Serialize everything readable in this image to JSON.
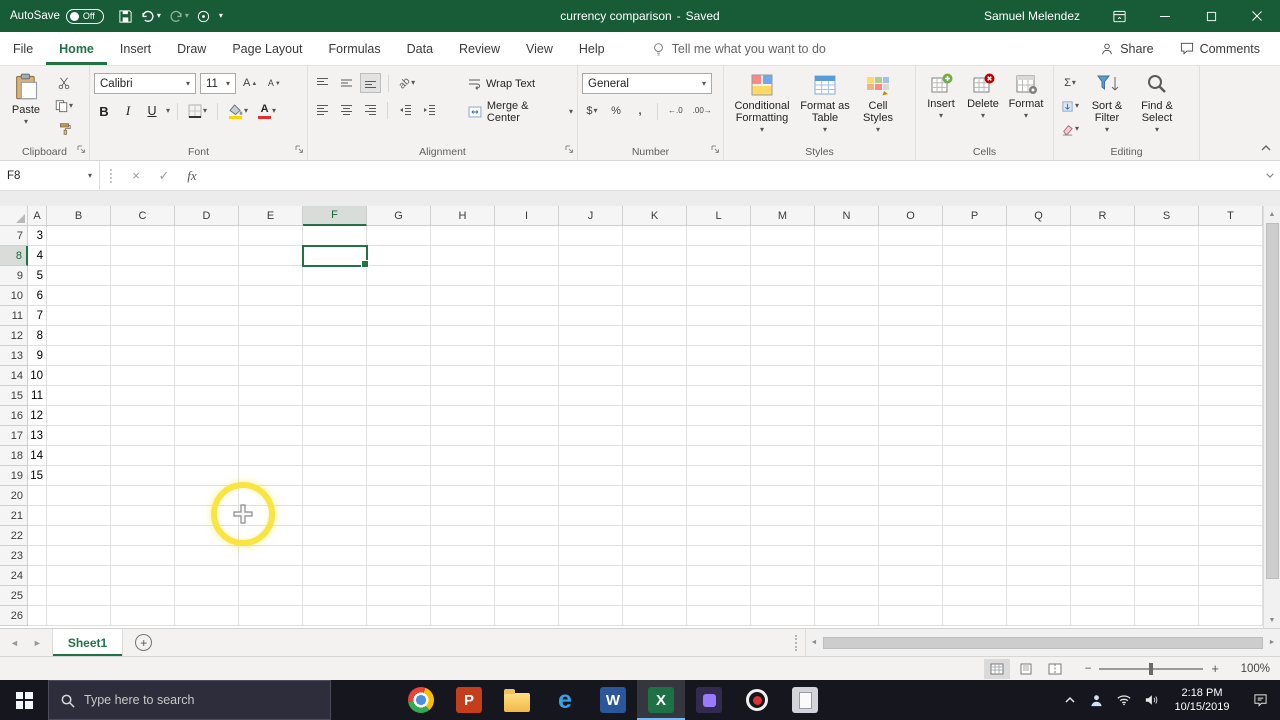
{
  "icons": {
    "dropdown": "▾",
    "up_arrow": "▲",
    "down_arrow": "▼",
    "left_arrow": "◄",
    "right_arrow": "►",
    "check": "✓",
    "cancel": "×",
    "sigma": "Σ",
    "plus": "+",
    "minus": "−",
    "increase_decimal_glyph": "←.0",
    "decrease_decimal_glyph": ".00→"
  },
  "titlebar": {
    "autosave_label": "AutoSave",
    "autosave_state": "Off",
    "document_title": "currency comparison",
    "separator": "-",
    "save_status": "Saved",
    "user_name": "Samuel Melendez"
  },
  "tab_row": {
    "tabs": [
      {
        "label": "File",
        "active": false
      },
      {
        "label": "Home",
        "active": true
      },
      {
        "label": "Insert",
        "active": false
      },
      {
        "label": "Draw",
        "active": false
      },
      {
        "label": "Page Layout",
        "active": false
      },
      {
        "label": "Formulas",
        "active": false
      },
      {
        "label": "Data",
        "active": false
      },
      {
        "label": "Review",
        "active": false
      },
      {
        "label": "View",
        "active": false
      },
      {
        "label": "Help",
        "active": false
      }
    ],
    "tell_me_placeholder": "Tell me what you want to do",
    "share_label": "Share",
    "comments_label": "Comments"
  },
  "ribbon": {
    "clipboard": {
      "group_label": "Clipboard",
      "paste_label": "Paste"
    },
    "font": {
      "group_label": "Font",
      "font_name": "Calibri",
      "font_size": "11",
      "bold": "B",
      "italic": "I",
      "underline": "U"
    },
    "alignment": {
      "group_label": "Alignment",
      "wrap_text_label": "Wrap Text",
      "merge_center_label": "Merge & Center",
      "orientation_glyph": "ab"
    },
    "number": {
      "group_label": "Number",
      "number_format": "General",
      "currency_symbol": "$",
      "percent_symbol": "%",
      "comma_symbol": ","
    },
    "styles": {
      "group_label": "Styles",
      "conditional_formatting_label": "Conditional Formatting",
      "format_as_table_label": "Format as Table",
      "cell_styles_label": "Cell Styles"
    },
    "cells": {
      "group_label": "Cells",
      "insert_label": "Insert",
      "delete_label": "Delete",
      "format_label": "Format"
    },
    "editing": {
      "group_label": "Editing",
      "sort_filter_label": "Sort & Filter",
      "find_select_label": "Find & Select"
    }
  },
  "formula_bar": {
    "name_box": "F8",
    "fx_label": "fx",
    "formula_value": ""
  },
  "grid": {
    "column_headers": [
      "A",
      "B",
      "C",
      "D",
      "E",
      "F",
      "G",
      "H",
      "I",
      "J",
      "K",
      "L",
      "M",
      "N",
      "O",
      "P",
      "Q",
      "R",
      "S",
      "T"
    ],
    "row_start": 7,
    "row_end": 26,
    "selected_cell": "F8",
    "selected_column": "F",
    "selected_row": 8,
    "column_a_values": {
      "7": "3",
      "8": "4",
      "9": "5",
      "10": "6",
      "11": "7",
      "12": "8",
      "13": "9",
      "14": "10",
      "15": "11",
      "16": "12",
      "17": "13",
      "18": "14",
      "19": "15"
    }
  },
  "sheet_bar": {
    "tabs": [
      {
        "name": "Sheet1",
        "active": true
      }
    ]
  },
  "status_bar": {
    "zoom_level": "100%"
  },
  "taskbar": {
    "search_placeholder": "Type here to search",
    "clock_time": "2:18 PM",
    "clock_date": "10/15/2019"
  }
}
